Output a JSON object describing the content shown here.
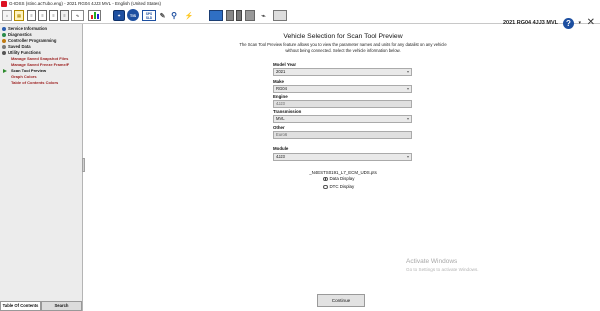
{
  "window": {
    "title": "G-IDSS (stinc.acTubo.eng) - 2021 RG04 4JJ3 MVL - English (United States)"
  },
  "toolbar": {
    "vehicle": "2021 RG04 4JJ3 MVL",
    "help_symbol": "?",
    "close_symbol": "✕",
    "tis_label": "TIS",
    "sps_top": "SPS",
    "sps_bottom": "SLD",
    "icons": [
      "home-icon",
      "book-icon",
      "document-icon",
      "document-icon",
      "document-icon",
      "document-icon",
      "graph-icon",
      "bar-chart-icon",
      "tech-tool-icon",
      "tis-icon",
      "sps-icon",
      "wrench-icon",
      "magnifier-icon",
      "probe-icon",
      "monitor-icon",
      "device-icon",
      "device-icon",
      "device-icon",
      "cable-icon",
      "printer-icon"
    ]
  },
  "sidebar": {
    "items": [
      {
        "label": "Service Information",
        "color": "#2a5db0"
      },
      {
        "label": "Diagnostics",
        "color": "#2a5db0"
      },
      {
        "label": "Controller Programming",
        "color": "#2a5db0"
      },
      {
        "label": "Saved Data",
        "color": "#2a5db0"
      },
      {
        "label": "Utility Functions",
        "color": "#2a5db0"
      }
    ],
    "subitems": [
      "Manage Saved Snapshot Files",
      "Manage Saved Freeze Frame/F",
      "Scan Tool Preview",
      "Graph Colors",
      "Table of Contents Colors"
    ],
    "active_subitem": "Scan Tool Preview",
    "tabs": {
      "toc": "Table Of Contents",
      "search": "Search"
    }
  },
  "main": {
    "heading": "Vehicle Selection for Scan Tool Preview",
    "description": "The Scan Tool Preview feature allows you to view the parameter names and units for any datalist on any vehicle without being connected.  Select the vehicle information below.",
    "fields": {
      "model_year": {
        "label": "Model Year",
        "value": "2021"
      },
      "make": {
        "label": "Make",
        "value": "RG04"
      },
      "engine": {
        "label": "Engine",
        "value": "4JJ3"
      },
      "transmission": {
        "label": "Transmission",
        "value": "MVL"
      },
      "other": {
        "label": "Other",
        "value": "Euro6"
      },
      "module": {
        "label": "Module",
        "value": "4JJ3"
      }
    },
    "file_name": "_N4ESTS0191_L7_ECM_UDS.pts",
    "radio_data": "Data Display",
    "radio_dtc": "DTC Display",
    "selected_display": "Data Display",
    "continue_label": "Continue"
  },
  "watermark": {
    "title": "Activate Windows",
    "subtitle": "Go to Settings to activate Windows."
  },
  "colors": {
    "accent": "#1d4fa0",
    "subitem": "#9b1c1c",
    "active_arrow": "#2e8b2e"
  }
}
